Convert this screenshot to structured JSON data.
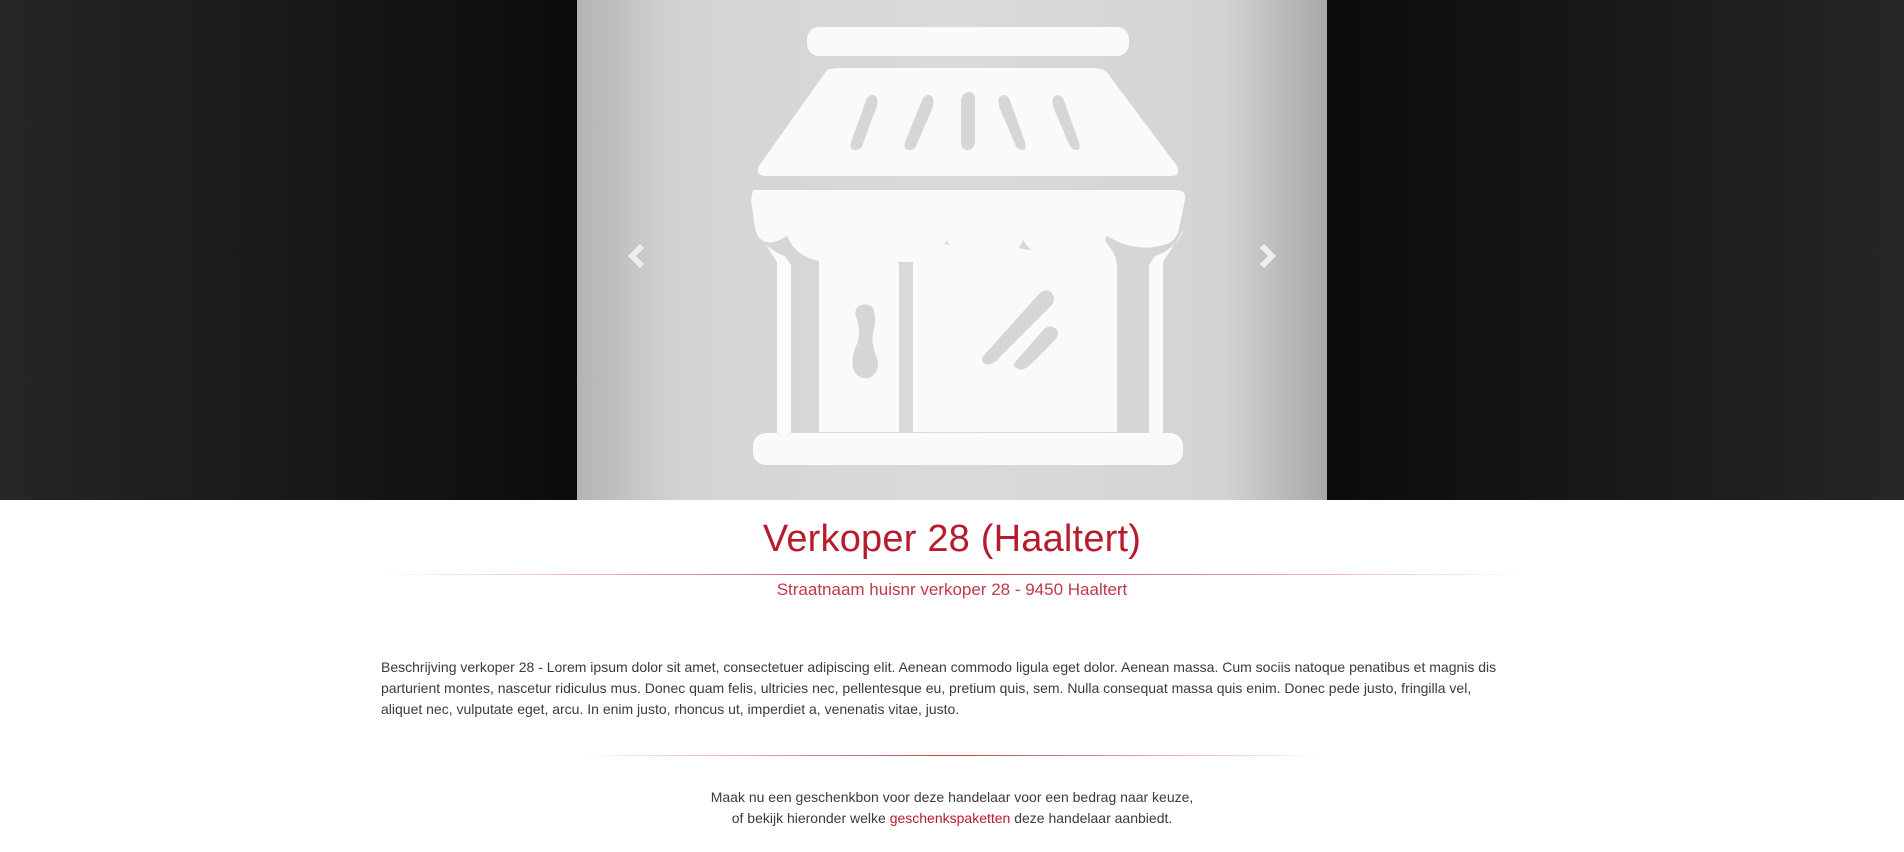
{
  "carousel": {
    "image_icon": "storefront-icon",
    "prev_icon": "chevron-left-icon",
    "next_icon": "chevron-right-icon"
  },
  "seller": {
    "title": "Verkoper 28 (Haaltert)",
    "address": "Straatnaam huisnr verkoper 28 - 9450 Haaltert",
    "description": "Beschrijving verkoper 28 - Lorem ipsum dolor sit amet, consectetuer adipiscing elit. Aenean commodo ligula eget dolor. Aenean massa. Cum sociis natoque penatibus et magnis dis parturient montes, nascetur ridiculus mus. Donec quam felis, ultricies nec, pellentesque eu, pretium quis, sem. Nulla consequat massa quis enim. Donec pede justo, fringilla vel, aliquet nec, vulputate eget, arcu. In enim justo, rhoncus ut, imperdiet a, venenatis vitae, justo."
  },
  "cta": {
    "line1": "Maak nu een geschenkbon voor deze handelaar voor een bedrag naar keuze,",
    "line2_before": "of bekijk hieronder welke ",
    "link_label": "geschenkspaketten",
    "line2_after": " deze handelaar aanbiedt."
  },
  "colors": {
    "accent": "#b71c2d",
    "text": "#3b3b3b",
    "hero_dark": "#0c0c0c",
    "slide_bg": "#dadada",
    "icon_fill": "#fafafa"
  }
}
